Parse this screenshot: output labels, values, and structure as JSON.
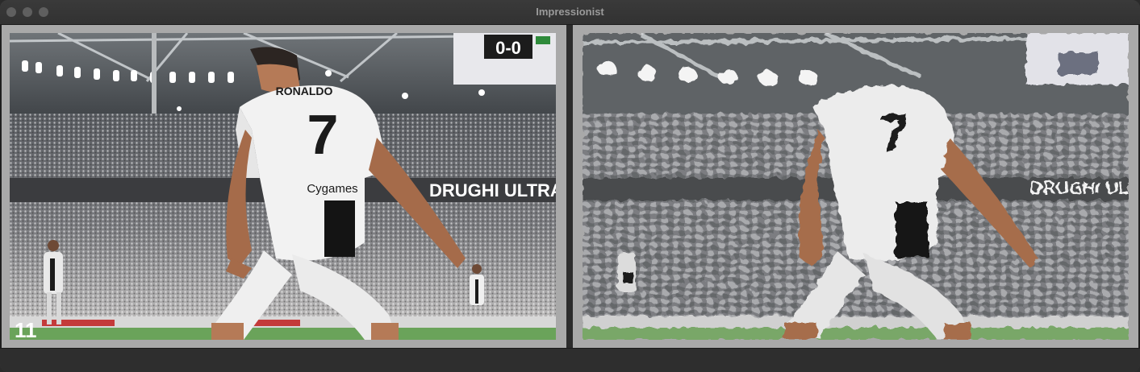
{
  "window": {
    "title": "Impressionist"
  },
  "panes": {
    "original": {
      "name": "original-image"
    },
    "painted": {
      "name": "impressionist-painted-image"
    }
  },
  "scene": {
    "jersey_name": "RONALDO",
    "jersey_number": "7",
    "sponsor": "Cygames",
    "banner_text": "DRUGHI ULTRA'",
    "scoreboard": "0-0",
    "corner_mark": "11"
  },
  "colors": {
    "window_bg": "#2a2a2a",
    "pane_bg": "#a9a9a9",
    "title_text": "#9a9a9a",
    "traffic_light": "#5f5f5f"
  }
}
